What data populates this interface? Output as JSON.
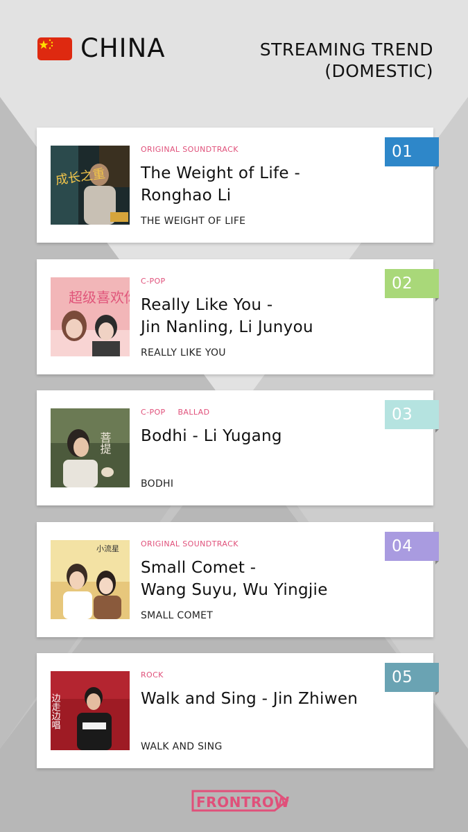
{
  "header": {
    "country": "CHINA",
    "flag_icon": "china-flag-icon",
    "chart_title_line1": "STREAMING TREND",
    "chart_title_line2": "(DOMESTIC)"
  },
  "entries": [
    {
      "rank": "01",
      "rank_color": "#2e87c9",
      "genres": [
        "ORIGINAL SOUNDTRACK"
      ],
      "title_line1": "The Weight of Life -",
      "title_line2": "Ronghao Li",
      "album": "THE WEIGHT OF LIFE",
      "cover_text": "成长之重"
    },
    {
      "rank": "02",
      "rank_color": "#a9d879",
      "genres": [
        "C-POP"
      ],
      "title_line1": "Really Like You -",
      "title_line2": "Jin Nanling, Li Junyou",
      "album": "REALLY LIKE YOU",
      "cover_text": "超级喜欢你"
    },
    {
      "rank": "03",
      "rank_color": "#b5e3e0",
      "genres": [
        "C-POP",
        "BALLAD"
      ],
      "title_line1": "Bodhi - Li Yugang",
      "title_line2": "",
      "album": "BODHI",
      "cover_text": "菩提"
    },
    {
      "rank": "04",
      "rank_color": "#a99be0",
      "genres": [
        "ORIGINAL SOUNDTRACK"
      ],
      "title_line1": "Small Comet -",
      "title_line2": "Wang Suyu, Wu Yingjie",
      "album": "SMALL COMET",
      "cover_text": "小流星"
    },
    {
      "rank": "05",
      "rank_color": "#6aa3b3",
      "genres": [
        "ROCK"
      ],
      "title_line1": "Walk and Sing - Jin Zhiwen",
      "title_line2": "",
      "album": "WALK AND SING",
      "cover_text": "边走边唱"
    }
  ],
  "footer": {
    "logo_text_1": "FRONT",
    "logo_text_2": "ROW",
    "logo_color": "#e0507a"
  }
}
